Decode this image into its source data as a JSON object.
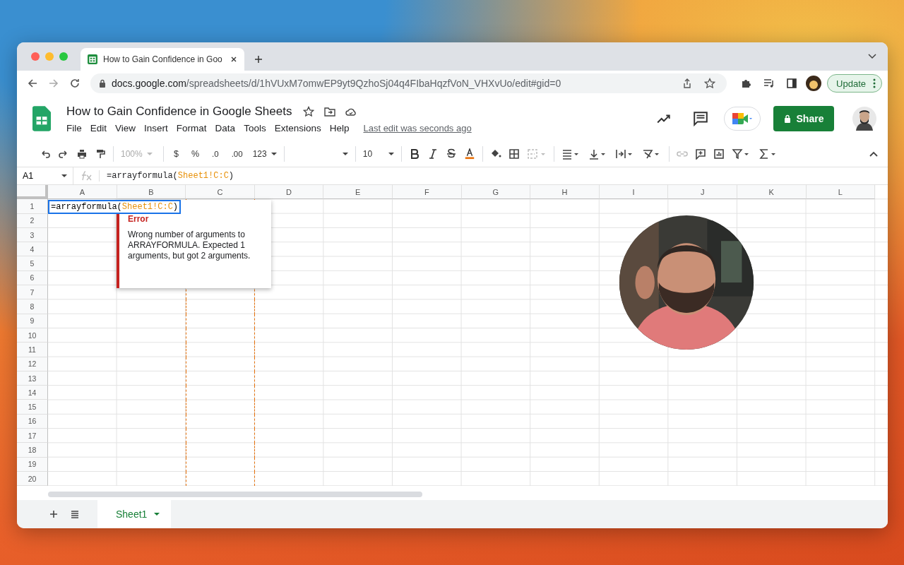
{
  "browser": {
    "tabs": [
      {
        "title": "How to Gain Confidence in Goo",
        "selected": true
      }
    ],
    "url_host": "docs.google.com",
    "url_path": "/spreadsheets/d/1hVUxM7omwEP9yt9QzhoSj04q4FIbaHqzfVoN_VHXvUo/edit#gid=0",
    "update_button": "Update"
  },
  "doc": {
    "title": "How to Gain Confidence in Google Sheets",
    "menus": [
      "File",
      "Edit",
      "View",
      "Insert",
      "Format",
      "Data",
      "Tools",
      "Extensions",
      "Help"
    ],
    "last_edit": "Last edit was seconds ago",
    "share_button": "Share"
  },
  "toolbar": {
    "zoom": "100%",
    "currency": "$",
    "percent": "%",
    "decrease_decimals": ".0",
    "increase_decimals": ".00",
    "number_format": "123",
    "font_size": "10"
  },
  "formula_bar": {
    "cell_ref": "A1",
    "formula": "=arrayformula(",
    "range": "Sheet1!C:C",
    "closing": ")"
  },
  "grid": {
    "columns": [
      {
        "label": "A",
        "referenced": false
      },
      {
        "label": "B",
        "referenced": false
      },
      {
        "label": "C",
        "referenced": true
      },
      {
        "label": "D",
        "referenced": false
      },
      {
        "label": "E",
        "referenced": false
      },
      {
        "label": "F",
        "referenced": false
      },
      {
        "label": "G",
        "referenced": false
      },
      {
        "label": "H",
        "referenced": false
      },
      {
        "label": "I",
        "referenced": false
      },
      {
        "label": "J",
        "referenced": false
      },
      {
        "label": "K",
        "referenced": false
      },
      {
        "label": "L",
        "referenced": false
      }
    ],
    "rows": [
      "1",
      "2",
      "3",
      "4",
      "5",
      "6",
      "7",
      "8",
      "9",
      "10",
      "11",
      "12",
      "13",
      "14",
      "15",
      "16",
      "17",
      "18",
      "19",
      "20"
    ],
    "editor": {
      "formula": "=arrayformula(",
      "range": "Sheet1!C:C",
      "closing": ")"
    }
  },
  "error_popup": {
    "title": "Error",
    "message": "Wrong number of arguments to ARRAYFORMULA. Expected 1 arguments, but got 2 arguments."
  },
  "sheets": [
    {
      "name": "Sheet1",
      "selected": true
    }
  ]
}
